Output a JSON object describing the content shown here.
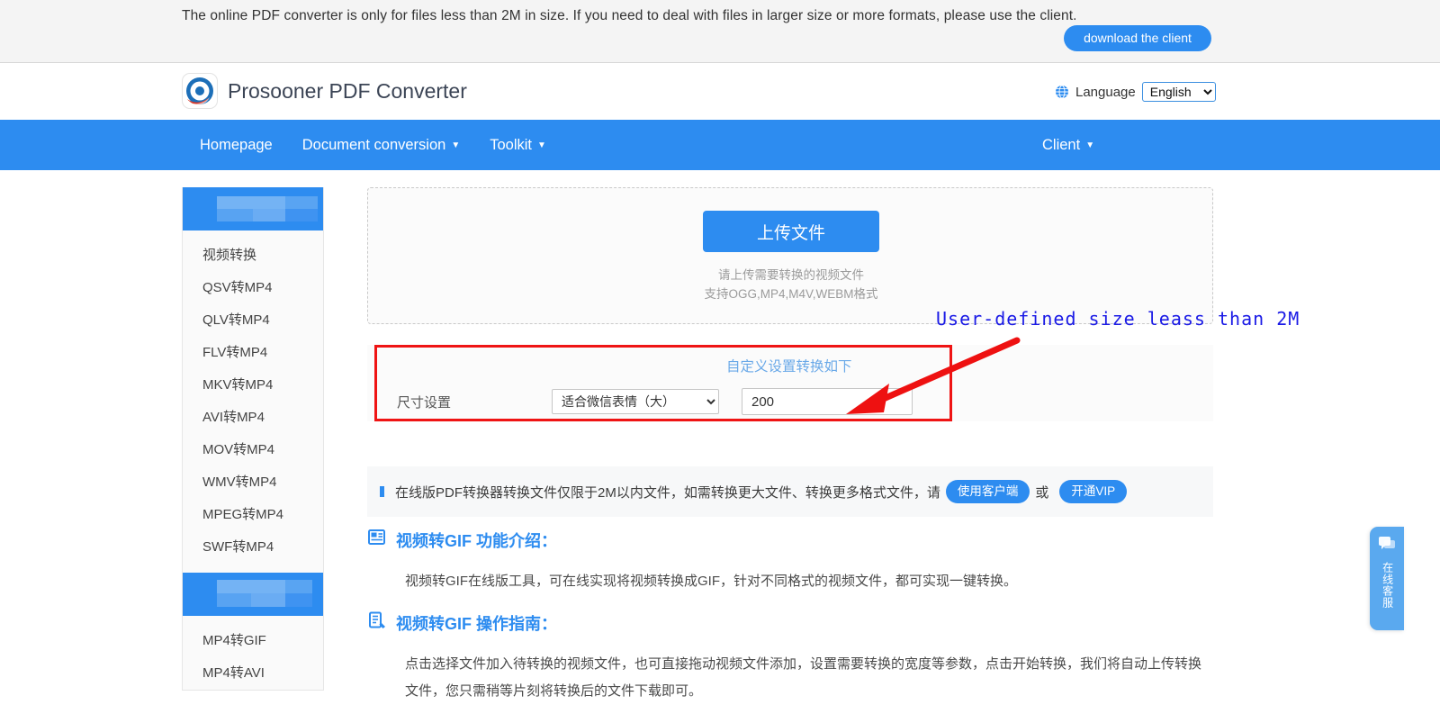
{
  "top_banner": {
    "notice": "The online PDF converter is only for files less than 2M in size. If you need to deal with files in larger size or more formats, please use the client.",
    "download_button": "download the client"
  },
  "header": {
    "logo_icon": "prosooner-logo-icon",
    "site_title": "Prosooner PDF Converter",
    "language": {
      "globe_icon": "globe-icon",
      "label": "Language",
      "selected": "English",
      "options": [
        "English"
      ]
    }
  },
  "nav": {
    "items": [
      {
        "label": "Homepage",
        "has_caret": false
      },
      {
        "label": "Document conversion",
        "has_caret": true
      },
      {
        "label": "Toolkit",
        "has_caret": true
      }
    ],
    "client": {
      "label": "Client",
      "has_caret": true
    },
    "redacted_blocks": 2,
    "caret_glyph": "▼"
  },
  "sidebar": {
    "group_one_header_redacted": true,
    "group_one_items": [
      "视频转换",
      "QSV转MP4",
      "QLV转MP4",
      "FLV转MP4",
      "MKV转MP4",
      "AVI转MP4",
      "MOV转MP4",
      "WMV转MP4",
      "MPEG转MP4",
      "SWF转MP4"
    ],
    "group_two_header_redacted": true,
    "group_two_items": [
      "MP4转GIF",
      "MP4转AVI"
    ]
  },
  "upload": {
    "button_label": "上传文件",
    "hint_line1": "请上传需要转换的视频文件",
    "hint_line2": "支持OGG,MP4,M4V,WEBM格式"
  },
  "settings": {
    "title": "自定义设置转换如下",
    "size_label": "尺寸设置",
    "preset_selected": "适合微信表情（大）",
    "preset_options": [
      "适合微信表情（大）"
    ],
    "size_value": "200",
    "highlight_color": "#ef1414"
  },
  "annotation": {
    "text": "User-defined size leass than 2M",
    "color": "#1a1ae6",
    "arrow_color": "#ee1111"
  },
  "notice_strip": {
    "text": "在线版PDF转换器转换文件仅限于2M以内文件，如需转换更大文件、转换更多格式文件，请",
    "button_client": "使用客户端",
    "separator": "或",
    "button_vip": "开通VIP"
  },
  "sections": [
    {
      "icon": "feature-intro-icon",
      "title": "视频转GIF 功能介绍：",
      "body": "视频转GIF在线版工具，可在线实现将视频转换成GIF，针对不同格式的视频文件，都可实现一键转换。"
    },
    {
      "icon": "guide-icon",
      "title": "视频转GIF 操作指南：",
      "body": "点击选择文件加入待转换的视频文件，也可直接拖动视频文件添加，设置需要转换的宽度等参数，点击开始转换，我们将自动上传转换文件，您只需稍等片刻将转换后的文件下载即可。"
    }
  ],
  "service_widget": {
    "icon": "chat-bubble-icon",
    "text": "在线客服"
  },
  "colors": {
    "brand_blue": "#2d8cf0",
    "nav_blue": "#2d8cf0",
    "banner_bg": "#f4f4f4"
  }
}
